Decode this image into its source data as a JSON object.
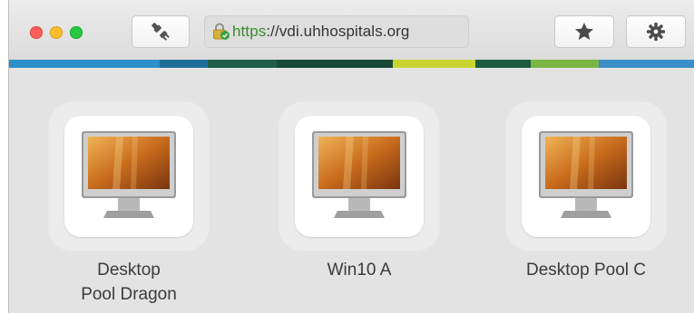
{
  "toolbar": {
    "url_scheme": "https",
    "url_rest": "://vdi.uhhospitals.org",
    "icons": {
      "close": "close-light",
      "minimize": "minimize-light",
      "zoom": "zoom-light",
      "disconnect": "plug-icon",
      "lock": "lock-icon",
      "favorite": "star-icon",
      "settings": "gear-icon"
    }
  },
  "colors": {
    "close": "#fc5f57",
    "minimize": "#fdbc2e",
    "zoom": "#28c840",
    "url_scheme": "#3a8a2d",
    "strip": [
      "#2e8fc9",
      "#1f6f9a",
      "#1f5e47",
      "#184a37",
      "#c8d52e",
      "#1d5b40",
      "#7bb642",
      "#3a8fc7"
    ]
  },
  "desktops": [
    {
      "label": "Desktop\nPool Dragon",
      "icon": "desktop-monitor-icon"
    },
    {
      "label": "Win10 A",
      "icon": "desktop-monitor-icon"
    },
    {
      "label": "Desktop Pool C",
      "icon": "desktop-monitor-icon"
    }
  ]
}
